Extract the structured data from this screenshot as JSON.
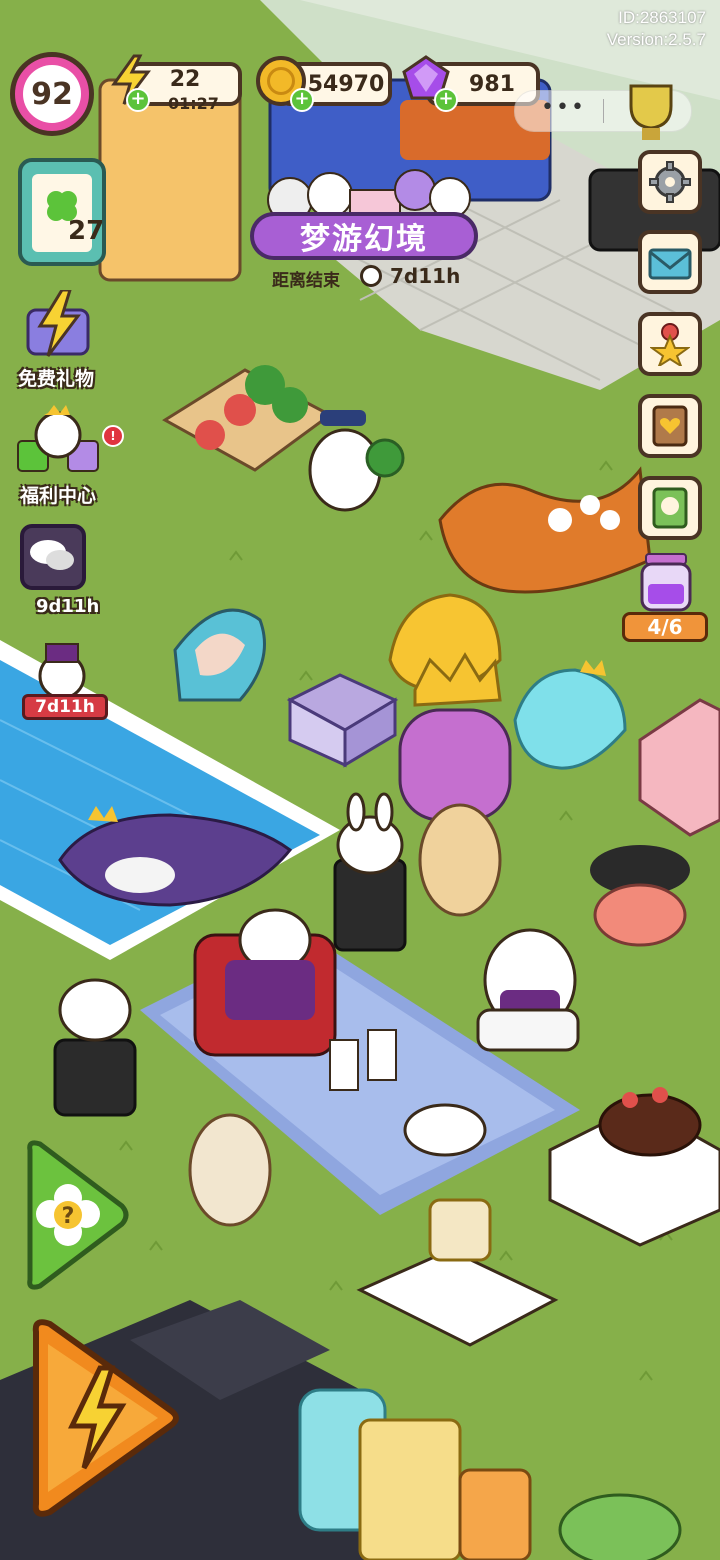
{
  "meta": {
    "id_text": "ID:2863107",
    "version_text": "Version:2.5.7"
  },
  "hud": {
    "level": "92",
    "energy": {
      "value": "22",
      "timer": "01:27"
    },
    "coins": {
      "value": "54970"
    },
    "gems": {
      "value": "981"
    }
  },
  "event_banner": {
    "title": "梦游幻境",
    "countdown_label": "距离结束",
    "countdown_value": "7d11h"
  },
  "left_panel": {
    "clipboard_count": "27",
    "free_gift_label": "免费礼物",
    "welfare_label": "福利中心",
    "chat_timer": "9d11h",
    "event_timer": "7d11h"
  },
  "right_panel": {
    "progress_text": "4/6"
  },
  "colors": {
    "grass": "#86b04a",
    "pool": "#3aa6e3",
    "wall": "#cfe0c8",
    "hud_border": "#4a3424",
    "level_pink": "#e94fa6",
    "coin_gold": "#f2b928",
    "gem_purple": "#a64de9"
  }
}
